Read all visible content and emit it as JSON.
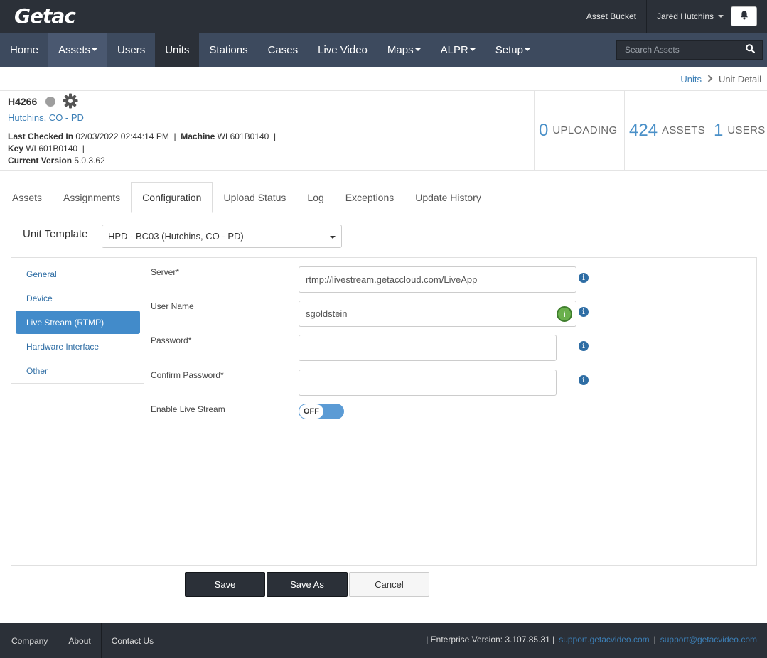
{
  "header": {
    "logo": "Getac",
    "asset_bucket": "Asset Bucket",
    "user_name": "Jared Hutchins",
    "bell_icon": "bell-icon"
  },
  "nav": {
    "items": [
      {
        "label": "Home"
      },
      {
        "label": "Assets"
      },
      {
        "label": "Users"
      },
      {
        "label": "Units"
      },
      {
        "label": "Stations"
      },
      {
        "label": "Cases"
      },
      {
        "label": "Live Video"
      },
      {
        "label": "Maps"
      },
      {
        "label": "ALPR"
      },
      {
        "label": "Setup"
      }
    ],
    "search_placeholder": "Search Assets"
  },
  "breadcrumb": {
    "parent": "Units",
    "current": "Unit Detail"
  },
  "unit": {
    "id": "H4266",
    "agency": "Hutchins, CO - PD",
    "last_checked_label": "Last Checked In",
    "last_checked_value": "02/03/2022 02:44:14 PM",
    "machine_label": "Machine",
    "machine_value": "WL601B0140",
    "key_label": "Key",
    "key_value": "WL601B0140",
    "version_label": "Current Version",
    "version_value": "5.0.3.62",
    "status_color": "#9e9e9e"
  },
  "stats": {
    "uploading_count": "0",
    "uploading_label": "UPLOADING",
    "assets_count": "424",
    "assets_label": "ASSETS",
    "users_count": "1",
    "users_label": "USERS"
  },
  "tabs": [
    {
      "label": "Assets"
    },
    {
      "label": "Assignments"
    },
    {
      "label": "Configuration"
    },
    {
      "label": "Upload Status"
    },
    {
      "label": "Log"
    },
    {
      "label": "Exceptions"
    },
    {
      "label": "Update History"
    }
  ],
  "template": {
    "label": "Unit Template",
    "value": "HPD - BC03 (Hutchins, CO - PD)"
  },
  "side_menu": [
    {
      "label": "General"
    },
    {
      "label": "Device"
    },
    {
      "label": "Live Stream (RTMP)"
    },
    {
      "label": "Hardware Interface"
    },
    {
      "label": "Other"
    }
  ],
  "form": {
    "server_label": "Server*",
    "server_value": "rtmp://livestream.getaccloud.com/LiveApp",
    "username_label": "User Name",
    "username_value": "sgoldstein",
    "password_label": "Password*",
    "password_value": "",
    "confirm_label": "Confirm Password*",
    "confirm_value": "",
    "enable_label": "Enable Live Stream",
    "enable_state": "OFF"
  },
  "buttons": {
    "save": "Save",
    "save_as": "Save As",
    "cancel": "Cancel"
  },
  "footer": {
    "company": "Company",
    "about": "About",
    "contact": "Contact Us",
    "version_text": "| Enterprise Version: 3.107.85.31 |",
    "support_site": "support.getacvideo.com",
    "sep": "|",
    "support_email": "support@getacvideo.com"
  },
  "colors": {
    "header_bg": "#2b3038",
    "nav_bg": "#3d4a5e",
    "accent": "#428bca",
    "stat_number": "#4a90c8"
  }
}
